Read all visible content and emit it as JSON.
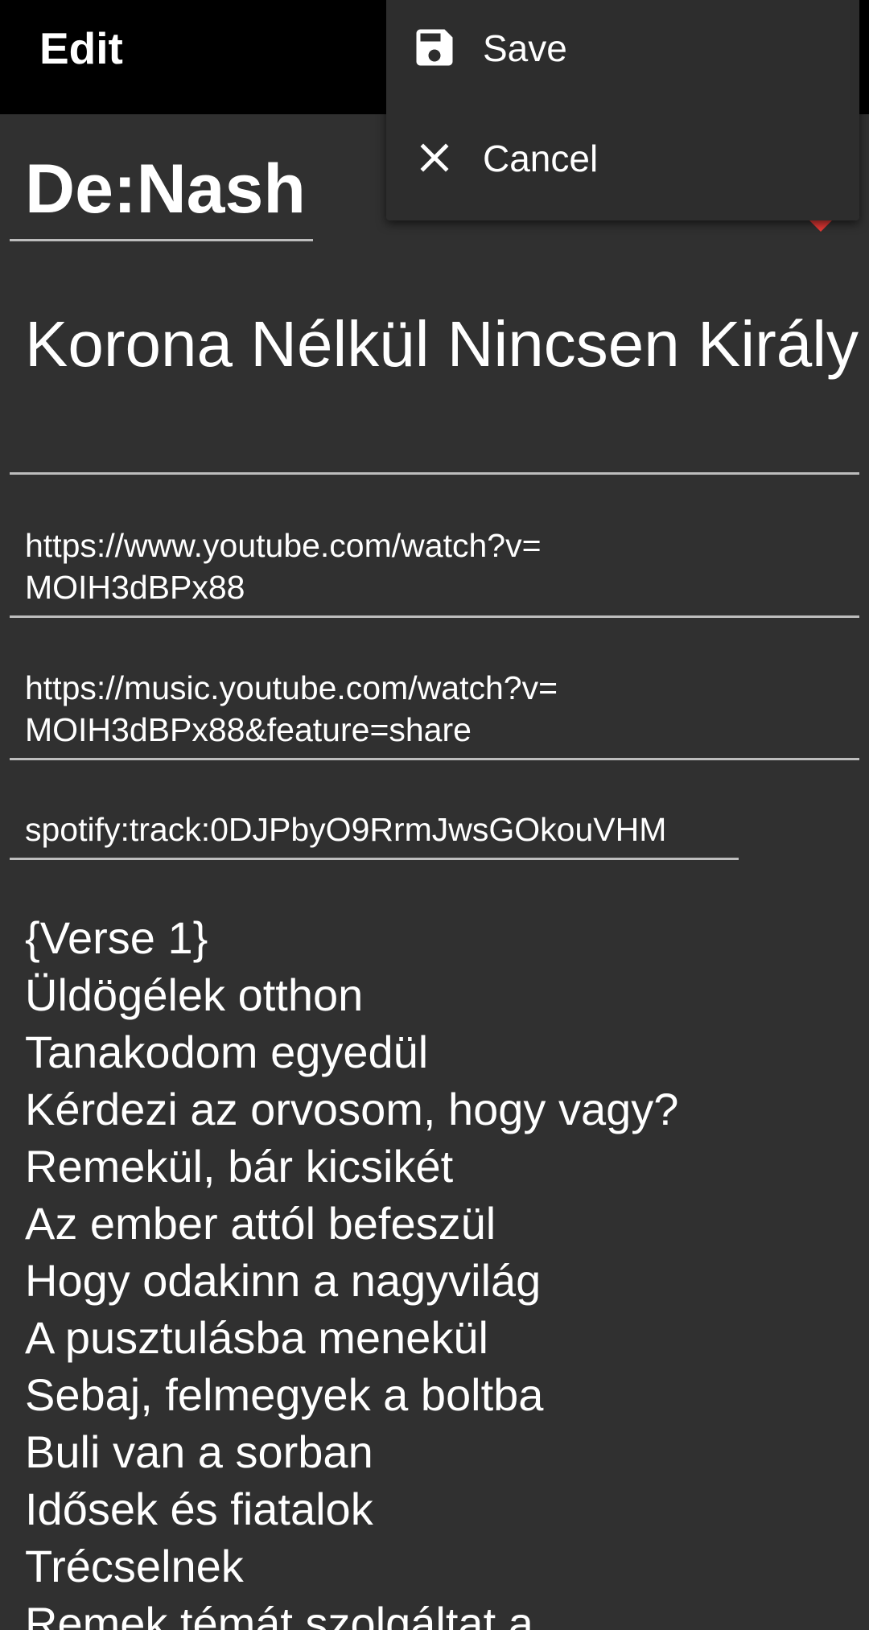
{
  "appbar": {
    "title": "Edit"
  },
  "menu": {
    "save_label": "Save",
    "save_icon": "save-icon",
    "cancel_label": "Cancel",
    "cancel_icon": "close-icon"
  },
  "form": {
    "artist": "De:Nash",
    "title": "Korona Nélkül Nincsen Király",
    "youtube_url_line1": "https://www.youtube.com/watch?v=",
    "youtube_url_line2": "MOIH3dBPx88",
    "youtube_music_url_line1": "https://music.youtube.com/watch?v=",
    "youtube_music_url_line2": "MOIH3dBPx88&feature=share",
    "spotify_uri": "spotify:track:0DJPbyO9RrmJwsGOkouVHM"
  },
  "lyrics": [
    "{Verse 1}",
    "Üldögélek otthon",
    "Tanakodom egyedül",
    "Kérdezi az orvosom, hogy vagy?",
    "Remekül, bár kicsikét",
    "Az ember attól befeszül",
    "Hogy odakinn a nagyvilág",
    "A pusztulásba menekül",
    "Sebaj, felmegyek a boltba",
    "Buli van a sorban",
    "Idősek és fiatalok",
    "Trécselnek",
    "Remek témát szolgáltat a"
  ],
  "colors": {
    "appbar_bg": "#000000",
    "background": "#303030",
    "menu_bg": "#2d2d2d",
    "accent": "#e53935",
    "underline": "#bdbdbd"
  }
}
